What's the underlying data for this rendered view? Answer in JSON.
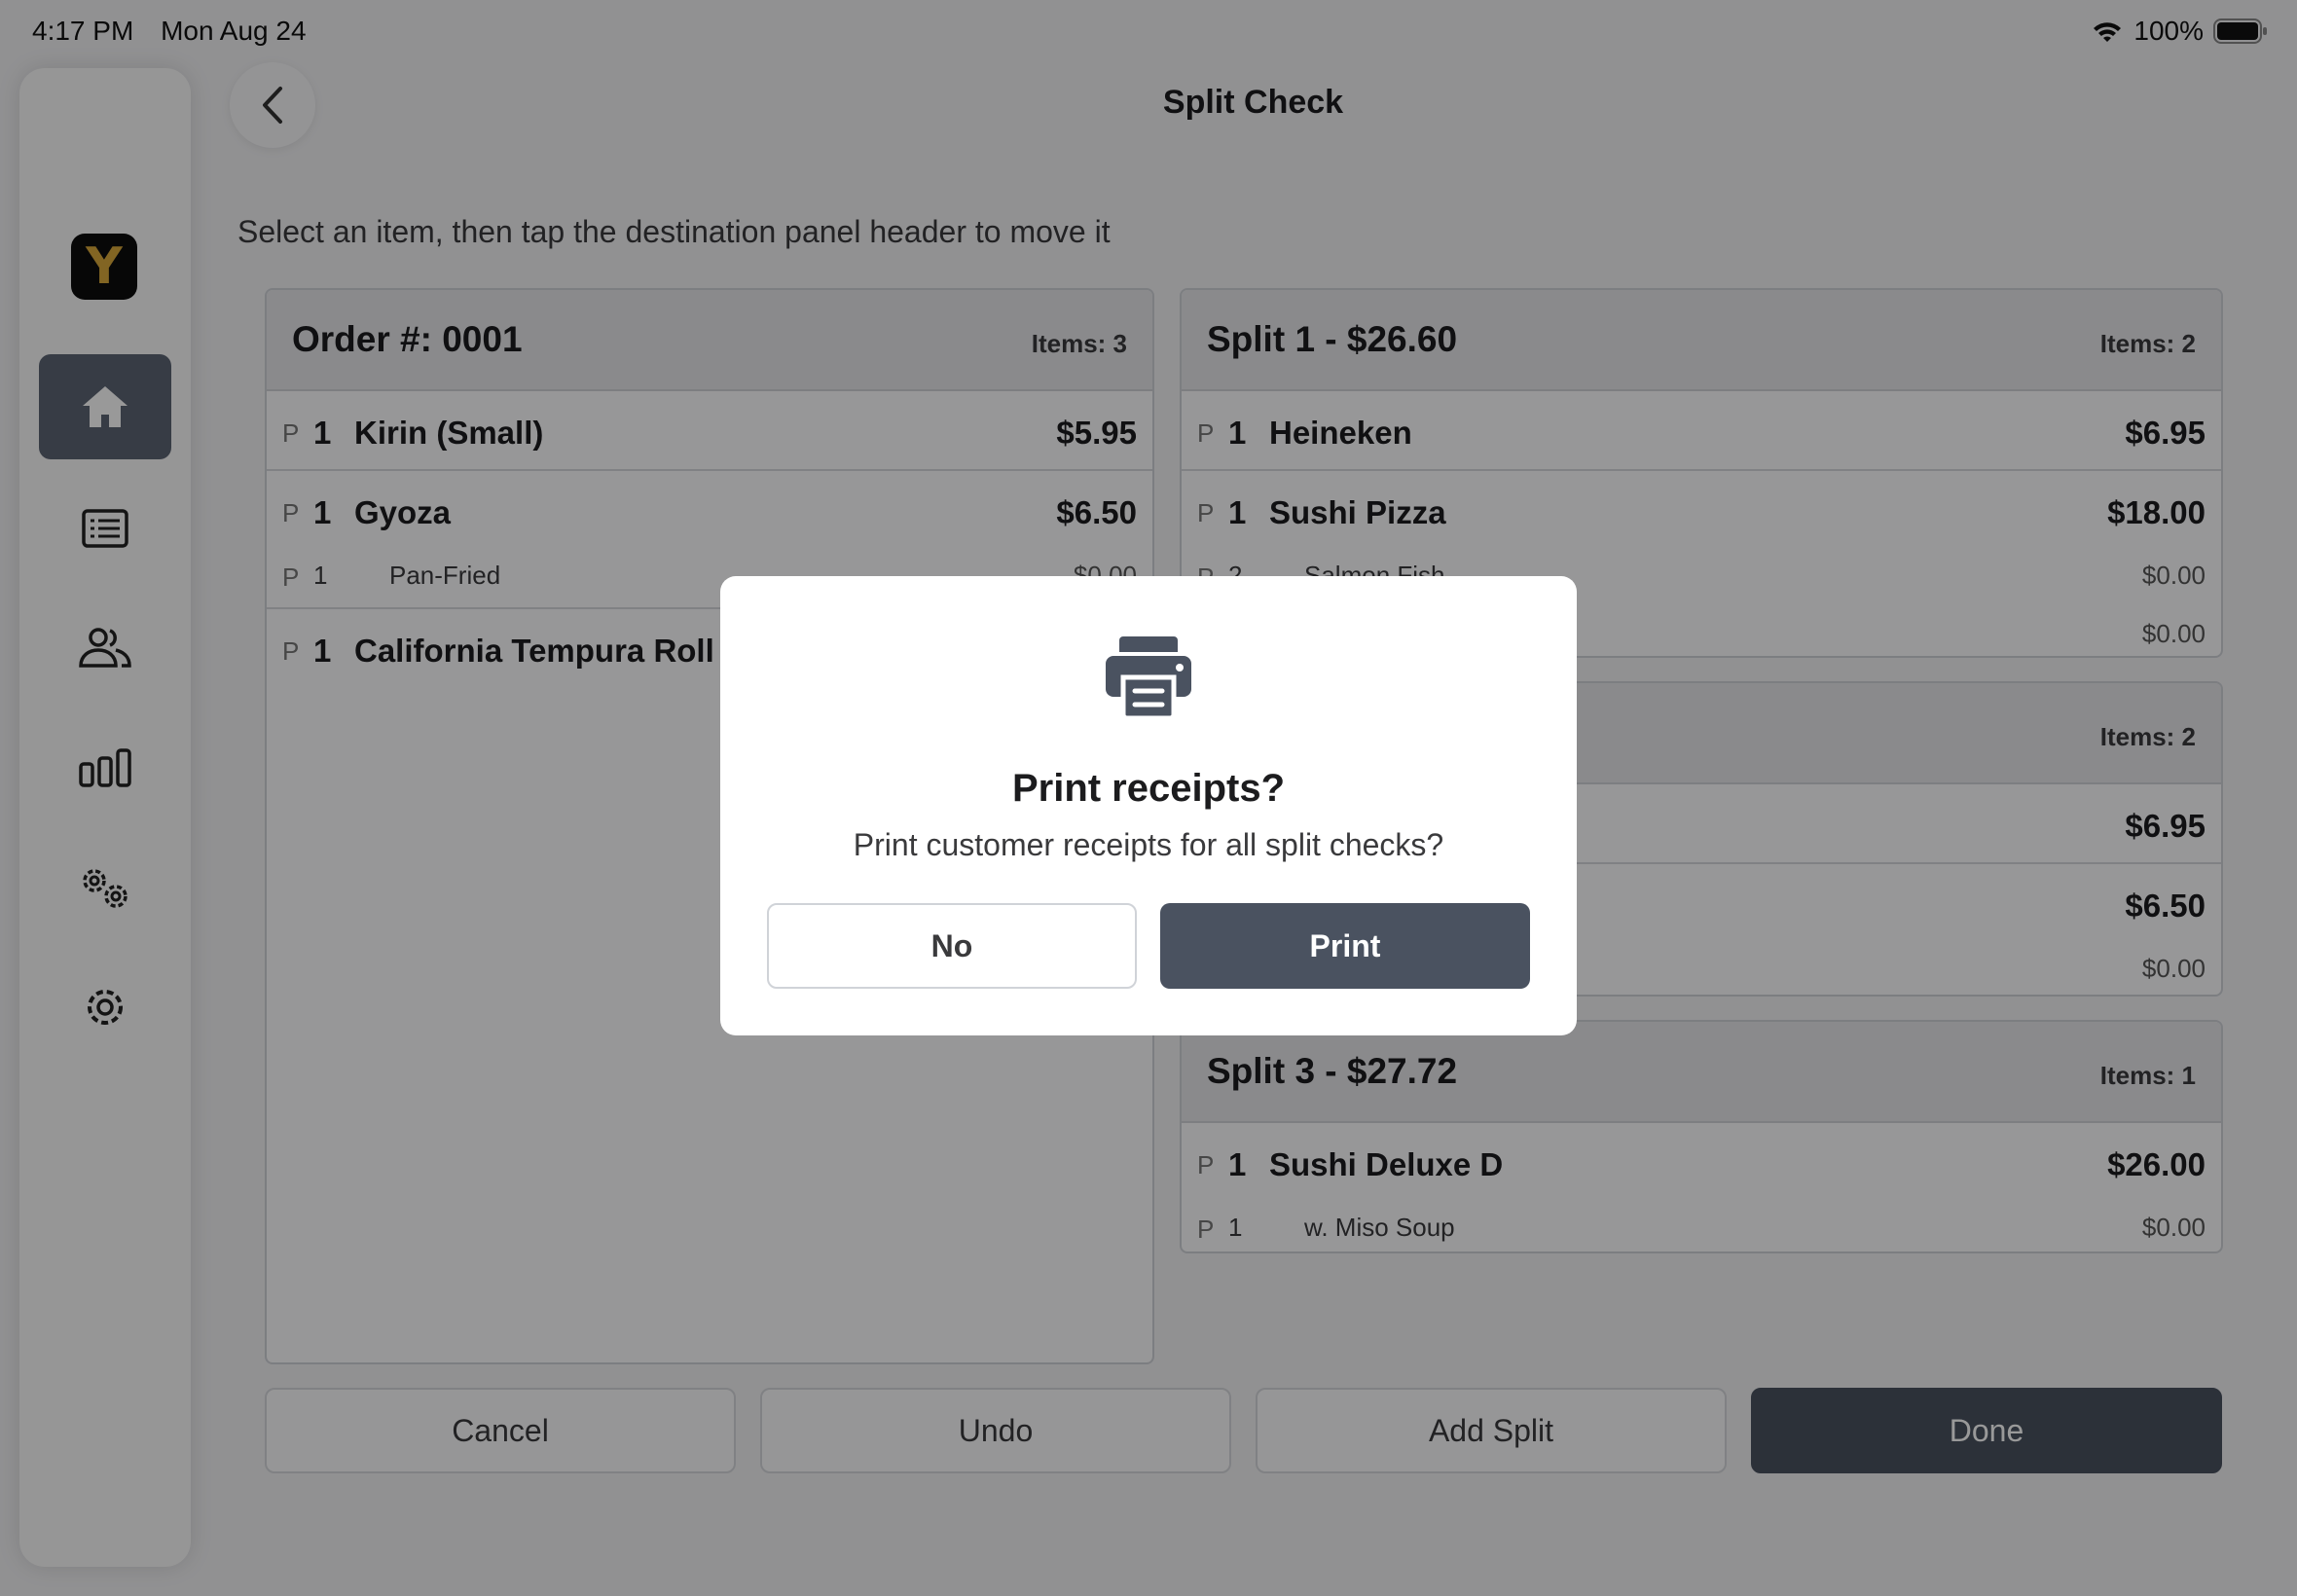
{
  "status": {
    "time": "4:17 PM",
    "date": "Mon Aug 24",
    "battery": "100%"
  },
  "header": {
    "title": "Split Check"
  },
  "instruction": "Select an item, then tap the destination panel header to move it",
  "sidebar": {
    "logo_letter": "Y"
  },
  "order": {
    "title": "Order #: 0001",
    "count": "Items: 3",
    "items": [
      {
        "p": "P",
        "qty": "1",
        "name": "Kirin (Small)",
        "price": "$5.95"
      },
      {
        "p": "P",
        "qty": "1",
        "name": "Gyoza",
        "price": "$6.50",
        "mod": {
          "p": "P",
          "qty": "1",
          "name": "Pan-Fried",
          "price": "$0.00"
        }
      },
      {
        "p": "P",
        "qty": "1",
        "name": "California Tempura Roll",
        "price": ""
      }
    ]
  },
  "split1": {
    "title": "Split 1 - $26.60",
    "count": "Items: 2",
    "items": [
      {
        "p": "P",
        "qty": "1",
        "name": "Heineken",
        "price": "$6.95"
      },
      {
        "p": "P",
        "qty": "1",
        "name": "Sushi Pizza",
        "price": "$18.00",
        "mod": {
          "p": "P",
          "qty": "2",
          "name": "Salmon Fish",
          "price": "$0.00"
        },
        "mod2_price": "$0.00"
      }
    ]
  },
  "split2": {
    "title": "",
    "count": "Items: 2",
    "items": [
      {
        "price": "$6.95"
      },
      {
        "price": "$6.50",
        "mod_price": "$0.00"
      }
    ]
  },
  "split3": {
    "title": "Split 3 - $27.72",
    "count": "Items: 1",
    "items": [
      {
        "p": "P",
        "qty": "1",
        "name": "Sushi Deluxe D",
        "price": "$26.00",
        "mod": {
          "p": "P",
          "qty": "1",
          "name": "w. Miso Soup",
          "price": "$0.00"
        }
      }
    ]
  },
  "actions": {
    "cancel": "Cancel",
    "undo": "Undo",
    "add_split": "Add Split",
    "done": "Done"
  },
  "dialog": {
    "icon": "printer-icon",
    "title": "Print receipts?",
    "message": "Print customer receipts for all split checks?",
    "no": "No",
    "print": "Print"
  }
}
